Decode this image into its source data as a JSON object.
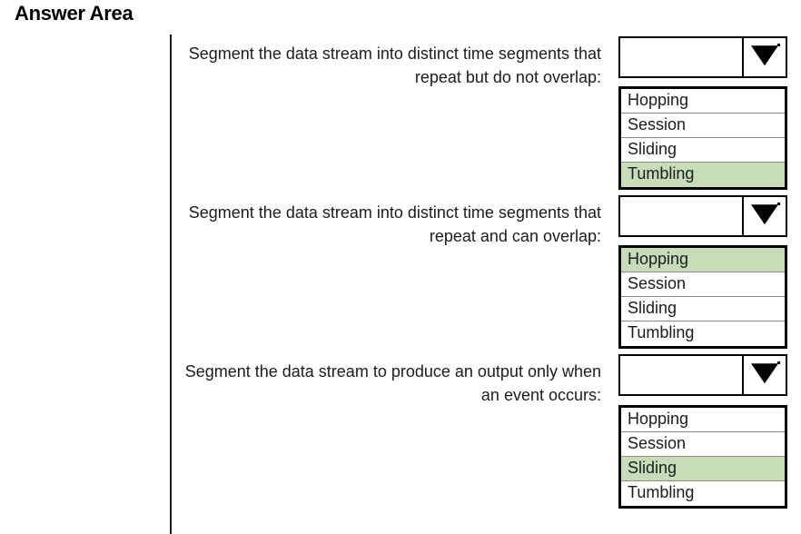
{
  "page": {
    "title": "Answer Area"
  },
  "icons": {
    "dropdown_arrow": "chevron-down-icon"
  },
  "colors": {
    "selection_green": "#c6ddb7",
    "border_black": "#000000",
    "text": "#1b1b21",
    "background": "#ffffff"
  },
  "rows": [
    {
      "prompt": "Segment the data stream into distinct time segments that repeat but do not overlap:",
      "selected_value": "",
      "options": [
        "Hopping",
        "Session",
        "Sliding",
        "Tumbling"
      ],
      "highlighted_option": "Tumbling"
    },
    {
      "prompt": "Segment the data stream into distinct time segments that repeat and can overlap:",
      "selected_value": "",
      "options": [
        "Hopping",
        "Session",
        "Sliding",
        "Tumbling"
      ],
      "highlighted_option": "Hopping"
    },
    {
      "prompt": "Segment the data stream to produce an output only when an event occurs:",
      "selected_value": "",
      "options": [
        "Hopping",
        "Session",
        "Sliding",
        "Tumbling"
      ],
      "highlighted_option": "Sliding"
    }
  ]
}
